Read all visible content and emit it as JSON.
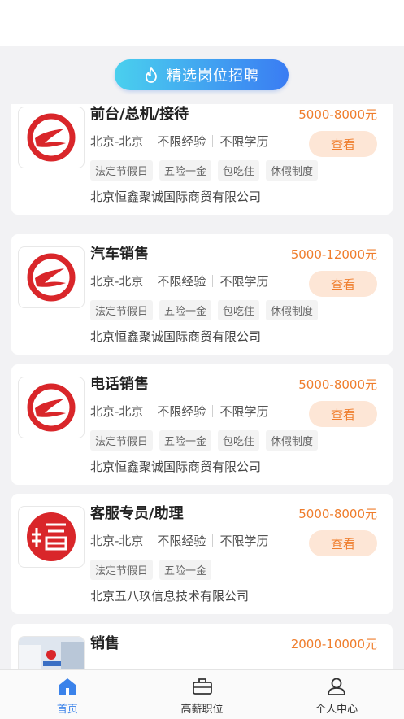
{
  "banner": {
    "label": "精选岗位招聘",
    "icon": "flame-icon"
  },
  "jobs": [
    {
      "title": "前台/总机/接待",
      "salary": "5000-8000元",
      "location": "北京-北京",
      "experience": "不限经验",
      "education": "不限学历",
      "view_label": "查看",
      "tags": [
        "法定节假日",
        "五险一金",
        "包吃住",
        "休假制度"
      ],
      "company": "北京恒鑫聚诚国际商贸有限公司",
      "logo": "red-swirl-logo"
    },
    {
      "title": "汽车销售",
      "salary": "5000-12000元",
      "location": "北京-北京",
      "experience": "不限经验",
      "education": "不限学历",
      "view_label": "查看",
      "tags": [
        "法定节假日",
        "五险一金",
        "包吃住",
        "休假制度"
      ],
      "company": "北京恒鑫聚诚国际商贸有限公司",
      "logo": "red-swirl-logo"
    },
    {
      "title": "电话销售",
      "salary": "5000-8000元",
      "location": "北京-北京",
      "experience": "不限经验",
      "education": "不限学历",
      "view_label": "查看",
      "tags": [
        "法定节假日",
        "五险一金",
        "包吃住",
        "休假制度"
      ],
      "company": "北京恒鑫聚诚国际商贸有限公司",
      "logo": "red-swirl-logo"
    },
    {
      "title": "客服专员/助理",
      "salary": "5000-8000元",
      "location": "北京-北京",
      "experience": "不限经验",
      "education": "不限学历",
      "view_label": "查看",
      "tags": [
        "法定节假日",
        "五险一金"
      ],
      "company": "北京五八玖信息技术有限公司",
      "logo": "red-seal-logo"
    },
    {
      "title": "销售",
      "salary": "2000-10000元",
      "logo": "office-photo-logo"
    }
  ],
  "tabbar": [
    {
      "label": "首页",
      "icon": "home-icon",
      "active": true
    },
    {
      "label": "高薪职位",
      "icon": "briefcase-icon",
      "active": false
    },
    {
      "label": "个人中心",
      "icon": "user-icon",
      "active": false
    }
  ],
  "colors": {
    "accent": "#3a82ea",
    "salary": "#ef7d2c",
    "brand_red": "#d9262a"
  }
}
